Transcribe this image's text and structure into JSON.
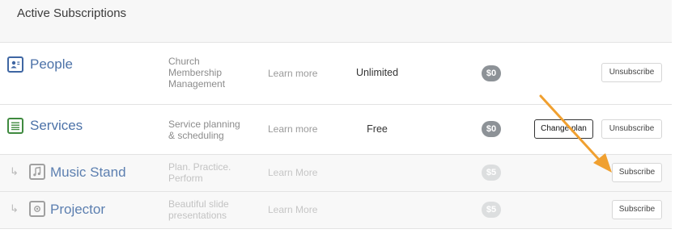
{
  "header": {
    "title": "Active Subscriptions"
  },
  "rows": [
    {
      "name": "People",
      "icon": "people-icon",
      "description": [
        "Church",
        "Membership",
        "Management"
      ],
      "learn_more": "Learn more",
      "plan": "Unlimited",
      "price": "$0",
      "actions": {
        "primary": "Unsubscribe"
      }
    },
    {
      "name": "Services",
      "icon": "services-list-icon",
      "description": [
        "Service planning",
        "& scheduling"
      ],
      "learn_more": "Learn more",
      "plan": "Free",
      "price": "$0",
      "actions": {
        "change": "Change plan",
        "primary": "Unsubscribe"
      }
    },
    {
      "name": "Music Stand",
      "icon": "music-note-icon",
      "sub_arrow": "↳",
      "description": [
        "Plan. Practice.",
        "Perform"
      ],
      "learn_more": "Learn More",
      "price": "$5",
      "actions": {
        "primary": "Subscribe"
      }
    },
    {
      "name": "Projector",
      "icon": "projector-icon",
      "sub_arrow": "↳",
      "description": [
        "Beautiful slide",
        "presentations"
      ],
      "learn_more": "Learn More",
      "price": "$5",
      "actions": {
        "primary": "Subscribe"
      }
    }
  ],
  "colors": {
    "app_blue": "#4c72a8",
    "people_icon": "#3f66a3",
    "services_icon": "#3f8a3f",
    "price_badge": "#8d9297",
    "annotation_arrow": "#f0a030"
  }
}
